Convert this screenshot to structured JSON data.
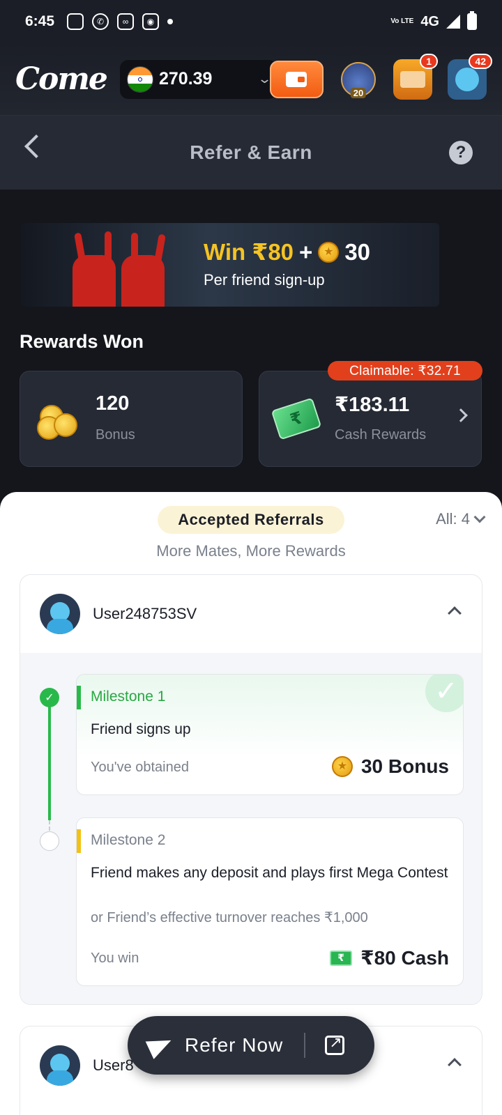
{
  "status_bar": {
    "time": "6:45",
    "network": "4G",
    "volte": "Vo LTE"
  },
  "header": {
    "logo_text": "Come",
    "balance": "270.39",
    "jackpot_label": "20",
    "chest_badge": "1",
    "profile_badge": "42"
  },
  "titlebar": {
    "title": "Refer & Earn",
    "help_icon": "?"
  },
  "banner": {
    "win_text": "Win ₹80",
    "plus": "+",
    "coins": "30",
    "per_text": "Per friend sign-up"
  },
  "rewards": {
    "title": "Rewards Won",
    "bonus_value": "120",
    "bonus_label": "Bonus",
    "cash_value": "₹183.11",
    "cash_label": "Cash Rewards",
    "claimable": "Claimable: ₹32.71"
  },
  "referrals": {
    "tab_label": "Accepted Referrals",
    "filter_label": "All: 4",
    "subtitle": "More Mates, More Rewards",
    "users": [
      {
        "name": "User248753SV",
        "milestones": [
          {
            "title": "Milestone 1",
            "description": "Friend signs up",
            "status_text": "You've obtained",
            "reward": "30 Bonus"
          },
          {
            "title": "Milestone 2",
            "description": "Friend makes any deposit and plays first Mega Contest",
            "alt_text": "or Friend’s effective turnover reaches ₹1,000",
            "status_text": "You win",
            "reward": "₹80 Cash"
          }
        ]
      },
      {
        "name": "User8"
      }
    ]
  },
  "refer_button": {
    "label": "Refer Now"
  },
  "colors": {
    "accent_green": "#29b94a",
    "accent_orange": "#f25c12",
    "claim_red": "#e2401c",
    "gold": "#f5c322"
  }
}
